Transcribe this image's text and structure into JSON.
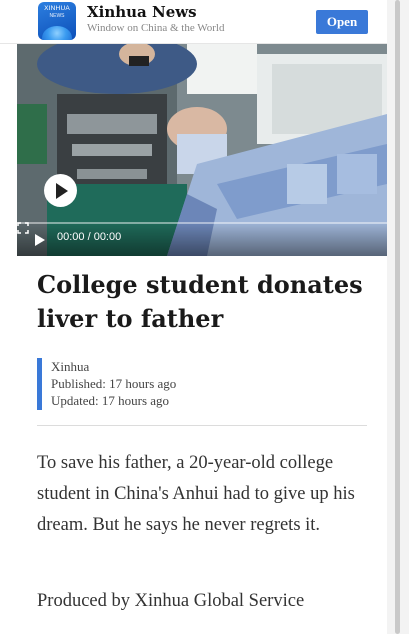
{
  "app_banner": {
    "logo_text": "XINHUA",
    "logo_subtext": "NEWS",
    "app_name": "Xinhua News",
    "tagline": "Window on China & the World",
    "open_label": "Open"
  },
  "video": {
    "time_display": "00:00 / 00:00",
    "progress": 0
  },
  "article": {
    "headline": "College student donates liver to father",
    "source": "Xinhua",
    "published": "Published: 17 hours ago",
    "updated": "Updated: 17 hours ago",
    "body": "To save his father, a 20-year-old college student in China's Anhui had to give up his dream. But he says he never regrets it.",
    "credit": "Produced by Xinhua Global Service"
  },
  "colors": {
    "accent": "#3a79d8",
    "text": "#333333"
  },
  "icons": [
    "play-icon",
    "fullscreen-icon",
    "xinhua-logo"
  ]
}
